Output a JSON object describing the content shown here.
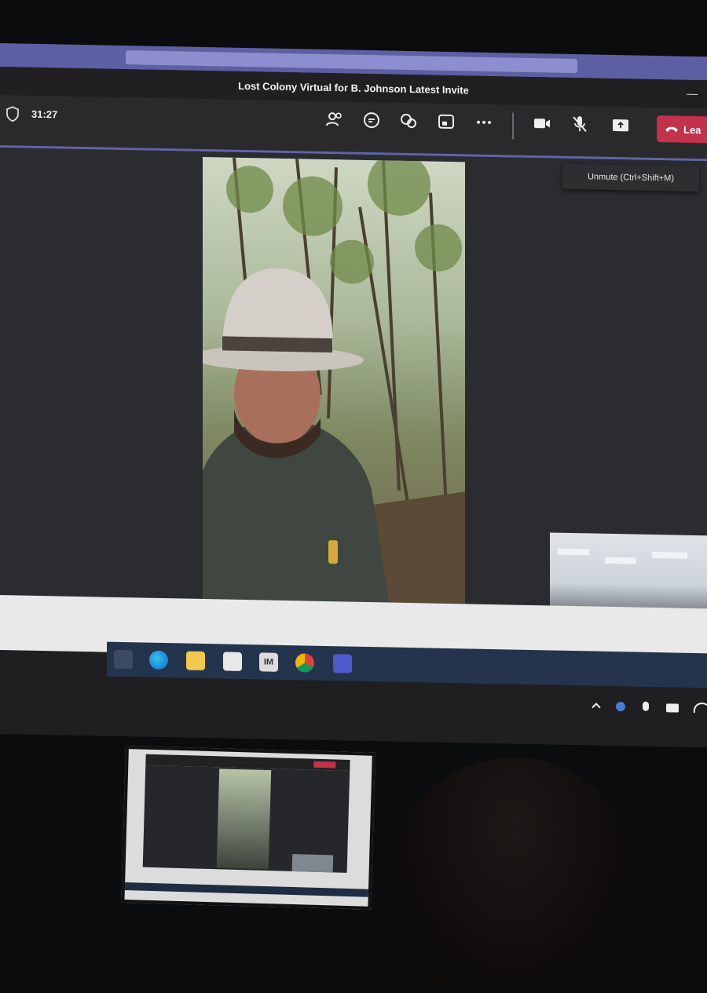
{
  "window": {
    "title": "Lost Colony Virtual for B. Johnson Latest Invite",
    "minimize_glyph": "—"
  },
  "toolbar": {
    "timer": "31:27",
    "icons": [
      "people-icon",
      "chat-icon",
      "reactions-icon",
      "rooms-icon",
      "more-icon",
      "camera-icon",
      "mic-muted-icon",
      "share-icon"
    ],
    "leave_label": "Lea",
    "leave_color": "#c4314b",
    "tooltip": "Unmute (Ctrl+Shift+M)",
    "accent": "#6264a7"
  },
  "taskbar": {
    "apps": [
      "task-view-icon",
      "edge-icon",
      "file-explorer-icon",
      "store-icon",
      "im-app-icon",
      "chrome-icon",
      "teams-icon"
    ],
    "im_label": "IM"
  }
}
